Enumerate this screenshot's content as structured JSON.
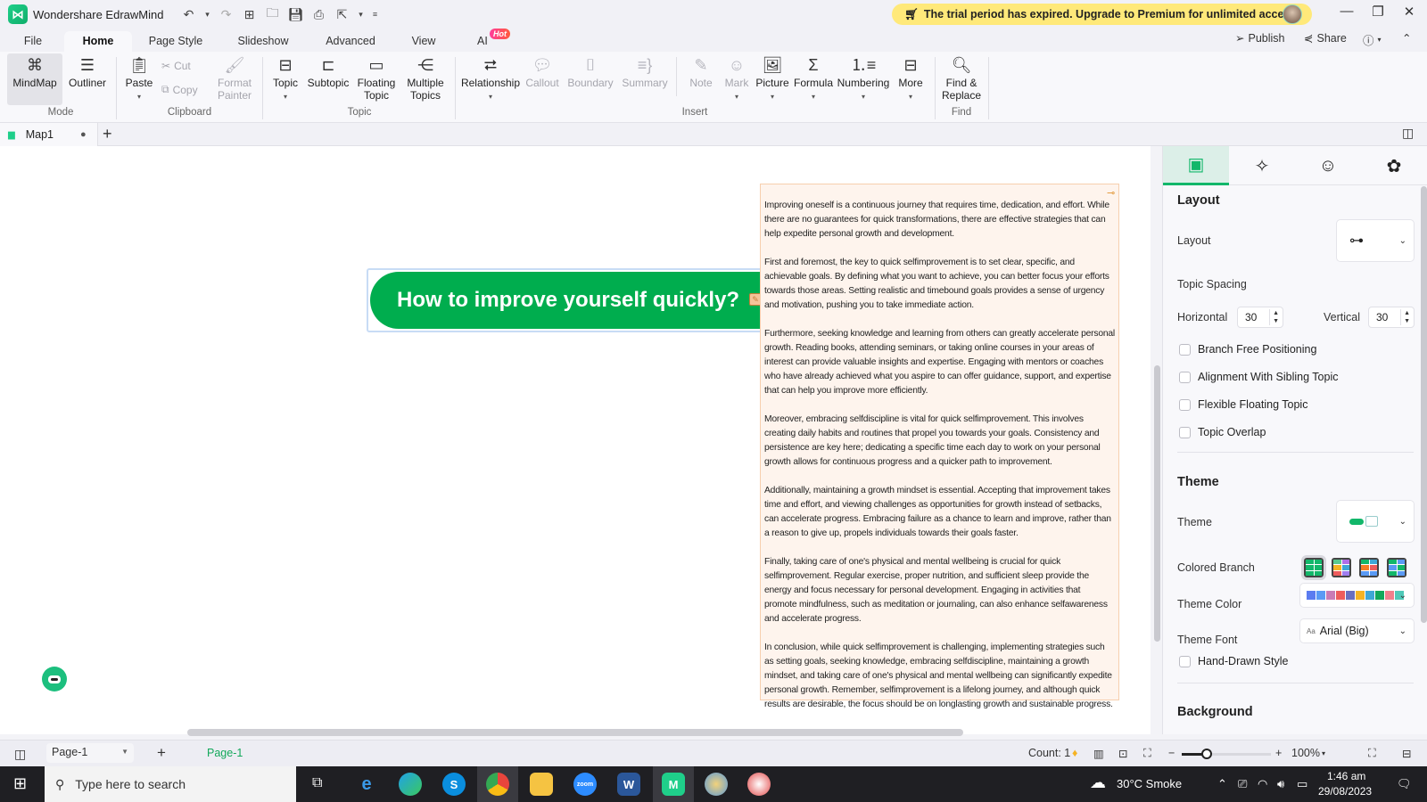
{
  "app": {
    "title": "Wondershare EdrawMind",
    "trial_banner": "The trial period has expired. Upgrade to Premium for unlimited access."
  },
  "menu": {
    "tabs": [
      {
        "label": "File"
      },
      {
        "label": "Home",
        "active": true
      },
      {
        "label": "Page Style"
      },
      {
        "label": "Slideshow"
      },
      {
        "label": "Advanced"
      },
      {
        "label": "View"
      },
      {
        "label": "AI",
        "badge": "Hot"
      }
    ],
    "publish_label": "Publish",
    "share_label": "Share"
  },
  "ribbon": {
    "mode": {
      "label": "Mode",
      "mindmap": "MindMap",
      "outliner": "Outliner"
    },
    "clipboard": {
      "label": "Clipboard",
      "paste": "Paste",
      "cut": "Cut",
      "copy": "Copy",
      "format_painter_1": "Format",
      "format_painter_2": "Painter"
    },
    "topic": {
      "label": "Topic",
      "topic": "Topic",
      "subtopic": "Subtopic",
      "floating_1": "Floating",
      "floating_2": "Topic",
      "multiple_1": "Multiple",
      "multiple_2": "Topics"
    },
    "insert": {
      "label": "Insert",
      "relationship": "Relationship",
      "callout": "Callout",
      "boundary": "Boundary",
      "summary": "Summary",
      "note": "Note",
      "mark": "Mark",
      "picture": "Picture",
      "formula": "Formula",
      "numbering": "Numbering",
      "more": "More"
    },
    "find": {
      "label": "Find",
      "find_replace_1": "Find &",
      "find_replace_2": "Replace"
    }
  },
  "document": {
    "tab_name": "Map1"
  },
  "canvas": {
    "main_topic": "How to improve yourself quickly?",
    "note_paragraphs": [
      "Improving oneself is a continuous journey that requires time, dedication, and effort. While there are no guarantees for quick transformations, there are effective strategies that can help expedite personal growth and development.",
      "First and foremost, the key to quick selfimprovement is to set clear, specific, and achievable goals. By defining what you want to achieve, you can better focus your efforts towards those areas. Setting realistic and timebound goals provides a sense of urgency and motivation, pushing you to take immediate action.",
      "Furthermore, seeking knowledge and learning from others can greatly accelerate personal growth. Reading books, attending seminars, or taking online courses in your areas of interest can provide valuable insights and expertise. Engaging with mentors or coaches who have already achieved what you aspire to can offer guidance, support, and expertise that can help you improve more efficiently.",
      "Moreover, embracing selfdiscipline is vital for quick selfimprovement. This involves creating daily habits and routines that propel you towards your goals. Consistency and persistence are key here; dedicating a specific time each day to work on your personal growth allows for continuous progress and a quicker path to improvement.",
      "Additionally, maintaining a growth mindset is essential. Accepting that improvement takes time and effort, and viewing challenges as opportunities for growth instead of setbacks, can accelerate progress. Embracing failure as a chance to learn and improve, rather than a reason to give up, propels individuals towards their goals faster.",
      "Finally, taking care of one's physical and mental wellbeing is crucial for quick selfimprovement. Regular exercise, proper nutrition, and sufficient sleep provide the energy and focus necessary for personal development. Engaging in activities that promote mindfulness, such as meditation or journaling, can also enhance selfawareness and accelerate progress.",
      "In conclusion, while quick selfimprovement is challenging, implementing strategies such as setting goals, seeking knowledge, embracing selfdiscipline, maintaining a growth mindset, and taking care of one's physical and mental wellbeing can significantly expedite personal growth. Remember, selfimprovement is a lifelong journey, and although quick results are desirable, the focus should be on longlasting growth and sustainable progress."
    ]
  },
  "panel": {
    "layout_heading": "Layout",
    "layout_label": "Layout",
    "topic_spacing_label": "Topic Spacing",
    "horizontal_label": "Horizontal",
    "horizontal_value": "30",
    "vertical_label": "Vertical",
    "vertical_value": "30",
    "checkboxes": [
      {
        "label": "Branch Free Positioning",
        "checked": false
      },
      {
        "label": "Alignment With Sibling Topic",
        "checked": false
      },
      {
        "label": "Flexible Floating Topic",
        "checked": false
      },
      {
        "label": "Topic Overlap",
        "checked": false
      }
    ],
    "theme_heading": "Theme",
    "theme_label": "Theme",
    "colored_branch_label": "Colored Branch",
    "theme_color_label": "Theme Color",
    "theme_colors": [
      "#5b7cf0",
      "#5a9af5",
      "#c97bb5",
      "#ee5c5c",
      "#6a6fc0",
      "#f5b324",
      "#3fa7d6",
      "#12a85a",
      "#f07f8c",
      "#4fc9b8"
    ],
    "theme_font_label": "Theme Font",
    "theme_font_value": "Arial (Big)",
    "hand_drawn_label": "Hand-Drawn Style",
    "background_heading": "Background"
  },
  "statusbar": {
    "page_select": "Page-1",
    "page_tab": "Page-1",
    "count": "Count: 1",
    "zoom": "100%"
  },
  "taskbar": {
    "search_placeholder": "Type here to search",
    "weather": "30°C  Smoke",
    "time": "1:46 am",
    "date": "29/08/2023"
  },
  "colors": {
    "accent": "#12b76a",
    "topic_fill": "#00ad4e",
    "note_bg": "#fef4ed",
    "trial_banner": "#ffe97a"
  }
}
